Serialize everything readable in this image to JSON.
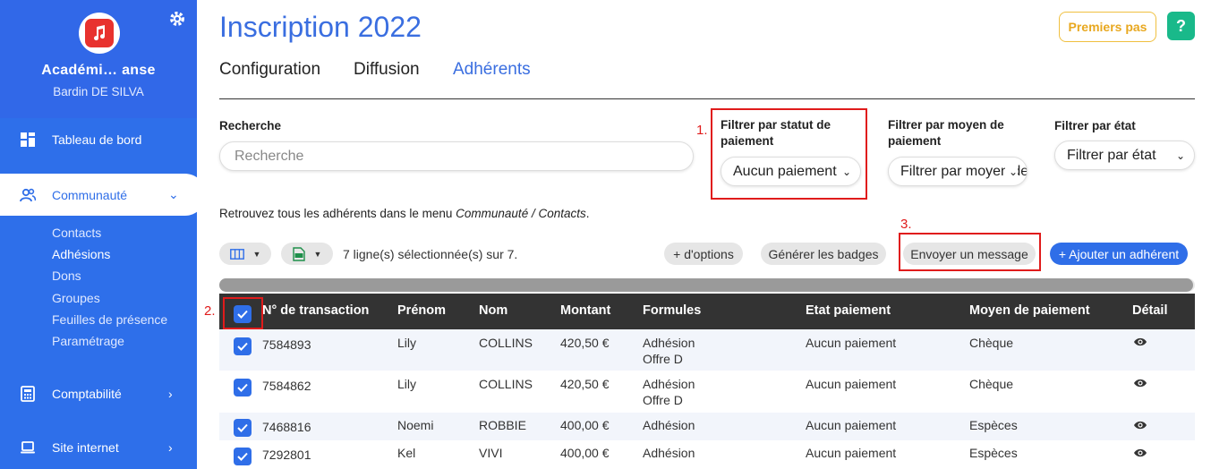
{
  "sidebar": {
    "org_name": "Académi… anse",
    "user_name": "Bardin DE SILVA",
    "nav": {
      "dashboard": "Tableau de bord",
      "community": "Communauté",
      "accounting": "Comptabilité",
      "website": "Site internet"
    },
    "subnav": [
      "Contacts",
      "Adhésions",
      "Dons",
      "Groupes",
      "Feuilles de présence",
      "Paramétrage"
    ],
    "colors": {
      "bg": "#2f6ee8",
      "logo_accent": "#e8322e"
    }
  },
  "header": {
    "title": "Inscription 2022",
    "premiers_pas": "Premiers pas",
    "help": "?",
    "tabs": [
      "Configuration",
      "Diffusion",
      "Adhérents"
    ],
    "active_tab": "Adhérents"
  },
  "filters": {
    "search_label": "Recherche",
    "search_placeholder": "Recherche",
    "status_label": "Filtrer par statut de paiement",
    "status_value": "Aucun paiement",
    "method_label": "Filtrer par moyen de paiement",
    "method_value": "Filtrer par moyen de paiement",
    "state_label": "Filtrer par état",
    "state_value": "Filtrer par état"
  },
  "info": {
    "text": "Retrouvez tous les adhérents dans le menu ",
    "path": "Communauté / Contacts",
    "suffix": "."
  },
  "annotations": [
    "1.",
    "2.",
    "3."
  ],
  "toolbar": {
    "selection": "7 ligne(s) sélectionnée(s) sur 7.",
    "more_options": "+ d'options",
    "badges": "Générer les badges",
    "message": "Envoyer un message",
    "add_member": "+ Ajouter un adhérent"
  },
  "table": {
    "columns": [
      "N° de transaction",
      "Prénom",
      "Nom",
      "Montant",
      "Formules",
      "Etat paiement",
      "Moyen de paiement",
      "Détail"
    ],
    "rows": [
      {
        "transaction": "7584893",
        "firstname": "Lily",
        "lastname": "COLLINS",
        "amount": "420,50 €",
        "formula1": "Adhésion",
        "formula2": "Offre D",
        "state": "Aucun paiement",
        "method": "Chèque"
      },
      {
        "transaction": "7584862",
        "firstname": "Lily",
        "lastname": "COLLINS",
        "amount": "420,50 €",
        "formula1": "Adhésion",
        "formula2": "Offre D",
        "state": "Aucun paiement",
        "method": "Chèque"
      },
      {
        "transaction": "7468816",
        "firstname": "Noemi",
        "lastname": "ROBBIE",
        "amount": "400,00 €",
        "formula1": "Adhésion",
        "formula2": "",
        "state": "Aucun paiement",
        "method": "Espèces"
      },
      {
        "transaction": "7292801",
        "firstname": "Kel",
        "lastname": "VIVI",
        "amount": "400,00 €",
        "formula1": "Adhésion",
        "formula2": "",
        "state": "Aucun paiement",
        "method": "Espèces"
      }
    ]
  }
}
